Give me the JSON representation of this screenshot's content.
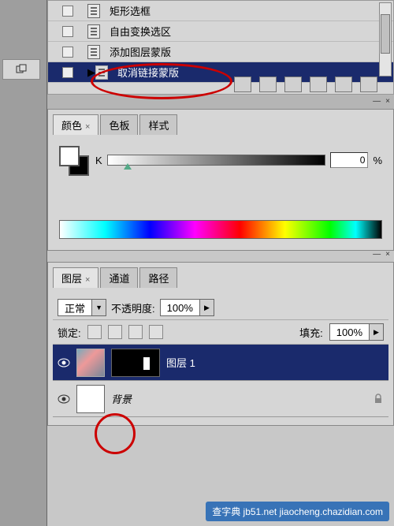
{
  "actions": {
    "items": [
      {
        "label": "矩形选框"
      },
      {
        "label": "自由变换选区"
      },
      {
        "label": "添加图层蒙版"
      },
      {
        "label": "取消链接蒙版"
      }
    ]
  },
  "colorPanel": {
    "tabs": [
      {
        "label": "颜色"
      },
      {
        "label": "色板"
      },
      {
        "label": "样式"
      }
    ],
    "channel": "K",
    "value": "0",
    "unit": "%"
  },
  "layersPanel": {
    "tabs": [
      {
        "label": "图层"
      },
      {
        "label": "通道"
      },
      {
        "label": "路径"
      }
    ],
    "blendMode": "正常",
    "opacityLabel": "不透明度:",
    "opacityValue": "100%",
    "lockLabel": "锁定:",
    "fillLabel": "填充:",
    "fillValue": "100%",
    "layers": [
      {
        "name": "图层 1"
      },
      {
        "name": "背景"
      }
    ]
  },
  "watermark": "查字典 jb51.net\njiaocheng.chazidian.com"
}
